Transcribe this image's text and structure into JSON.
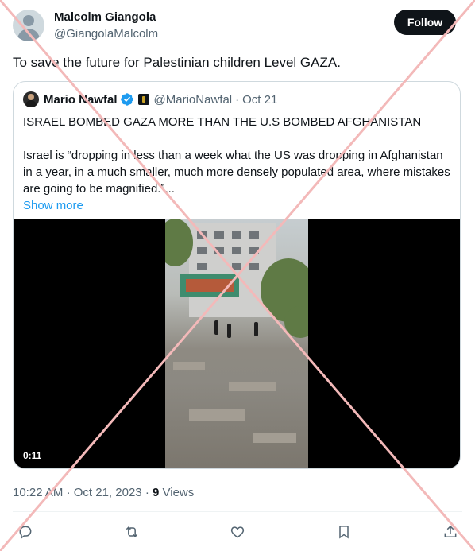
{
  "author": {
    "name": "Malcolm Giangola",
    "handle": "@GiangolaMalcolm",
    "avatar_icon": "default-avatar-icon"
  },
  "follow_label": "Follow",
  "tweet_text": "To save the future for Palestinian children Level GAZA.",
  "quote": {
    "name": "Mario Nawfal",
    "handle": "@MarioNawfal",
    "separator": "·",
    "date": "Oct 21",
    "line1": "ISRAEL BOMBED GAZA MORE THAN THE U.S BOMBED AFGHANISTAN",
    "line2": "Israel is “dropping in less than a week what the US was dropping in Afghanistan in a year, in a much smaller, much more densely populated area, where mistakes are going to be magnified.”...",
    "show_more": "Show more",
    "video_time": "0:11",
    "verified_color": "#1d9bf0"
  },
  "meta": {
    "time": "10:22 AM",
    "sep1": "·",
    "date": "Oct 21, 2023",
    "sep2": "·",
    "views_count": "9",
    "views_label": "Views"
  },
  "actions": [
    "reply-icon",
    "retweet-icon",
    "like-icon",
    "bookmark-icon",
    "share-icon"
  ],
  "watermark_color": "#f3b9b9"
}
